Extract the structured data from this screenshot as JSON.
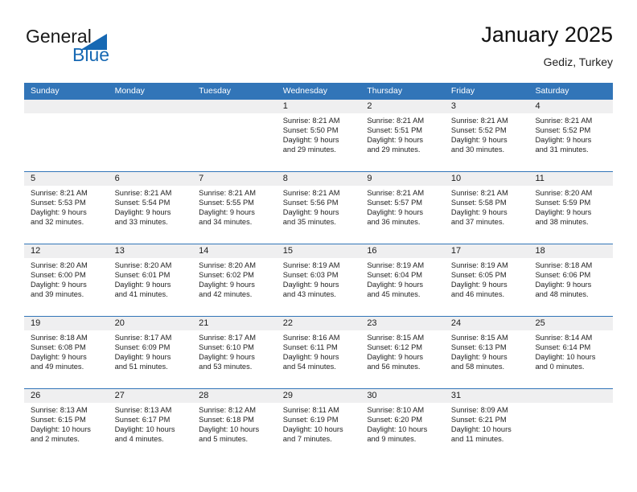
{
  "brand": {
    "name_part1": "General",
    "name_part2": "Blue",
    "logo_icon": "triangle-flag-icon",
    "color_blue": "#1668b3"
  },
  "header": {
    "title": "January 2025",
    "subtitle": "Gediz, Turkey"
  },
  "theme": {
    "header_blue": "#3275b8",
    "day_band_gray": "#efeff0",
    "text_dark": "#222222"
  },
  "weekday_headers": [
    "Sunday",
    "Monday",
    "Tuesday",
    "Wednesday",
    "Thursday",
    "Friday",
    "Saturday"
  ],
  "labels": {
    "sunrise_prefix": "Sunrise:",
    "sunset_prefix": "Sunset:",
    "daylight_prefix": "Daylight:"
  },
  "weeks": [
    {
      "days": [
        {
          "number": "",
          "line1": "",
          "line2": "",
          "line3": "",
          "line4": "",
          "empty": true
        },
        {
          "number": "",
          "line1": "",
          "line2": "",
          "line3": "",
          "line4": "",
          "empty": true
        },
        {
          "number": "",
          "line1": "",
          "line2": "",
          "line3": "",
          "line4": "",
          "empty": true
        },
        {
          "number": "1",
          "line1": "Sunrise: 8:21 AM",
          "line2": "Sunset: 5:50 PM",
          "line3": "Daylight: 9 hours",
          "line4": "and 29 minutes.",
          "empty": false
        },
        {
          "number": "2",
          "line1": "Sunrise: 8:21 AM",
          "line2": "Sunset: 5:51 PM",
          "line3": "Daylight: 9 hours",
          "line4": "and 29 minutes.",
          "empty": false
        },
        {
          "number": "3",
          "line1": "Sunrise: 8:21 AM",
          "line2": "Sunset: 5:52 PM",
          "line3": "Daylight: 9 hours",
          "line4": "and 30 minutes.",
          "empty": false
        },
        {
          "number": "4",
          "line1": "Sunrise: 8:21 AM",
          "line2": "Sunset: 5:52 PM",
          "line3": "Daylight: 9 hours",
          "line4": "and 31 minutes.",
          "empty": false
        }
      ]
    },
    {
      "days": [
        {
          "number": "5",
          "line1": "Sunrise: 8:21 AM",
          "line2": "Sunset: 5:53 PM",
          "line3": "Daylight: 9 hours",
          "line4": "and 32 minutes.",
          "empty": false
        },
        {
          "number": "6",
          "line1": "Sunrise: 8:21 AM",
          "line2": "Sunset: 5:54 PM",
          "line3": "Daylight: 9 hours",
          "line4": "and 33 minutes.",
          "empty": false
        },
        {
          "number": "7",
          "line1": "Sunrise: 8:21 AM",
          "line2": "Sunset: 5:55 PM",
          "line3": "Daylight: 9 hours",
          "line4": "and 34 minutes.",
          "empty": false
        },
        {
          "number": "8",
          "line1": "Sunrise: 8:21 AM",
          "line2": "Sunset: 5:56 PM",
          "line3": "Daylight: 9 hours",
          "line4": "and 35 minutes.",
          "empty": false
        },
        {
          "number": "9",
          "line1": "Sunrise: 8:21 AM",
          "line2": "Sunset: 5:57 PM",
          "line3": "Daylight: 9 hours",
          "line4": "and 36 minutes.",
          "empty": false
        },
        {
          "number": "10",
          "line1": "Sunrise: 8:21 AM",
          "line2": "Sunset: 5:58 PM",
          "line3": "Daylight: 9 hours",
          "line4": "and 37 minutes.",
          "empty": false
        },
        {
          "number": "11",
          "line1": "Sunrise: 8:20 AM",
          "line2": "Sunset: 5:59 PM",
          "line3": "Daylight: 9 hours",
          "line4": "and 38 minutes.",
          "empty": false
        }
      ]
    },
    {
      "days": [
        {
          "number": "12",
          "line1": "Sunrise: 8:20 AM",
          "line2": "Sunset: 6:00 PM",
          "line3": "Daylight: 9 hours",
          "line4": "and 39 minutes.",
          "empty": false
        },
        {
          "number": "13",
          "line1": "Sunrise: 8:20 AM",
          "line2": "Sunset: 6:01 PM",
          "line3": "Daylight: 9 hours",
          "line4": "and 41 minutes.",
          "empty": false
        },
        {
          "number": "14",
          "line1": "Sunrise: 8:20 AM",
          "line2": "Sunset: 6:02 PM",
          "line3": "Daylight: 9 hours",
          "line4": "and 42 minutes.",
          "empty": false
        },
        {
          "number": "15",
          "line1": "Sunrise: 8:19 AM",
          "line2": "Sunset: 6:03 PM",
          "line3": "Daylight: 9 hours",
          "line4": "and 43 minutes.",
          "empty": false
        },
        {
          "number": "16",
          "line1": "Sunrise: 8:19 AM",
          "line2": "Sunset: 6:04 PM",
          "line3": "Daylight: 9 hours",
          "line4": "and 45 minutes.",
          "empty": false
        },
        {
          "number": "17",
          "line1": "Sunrise: 8:19 AM",
          "line2": "Sunset: 6:05 PM",
          "line3": "Daylight: 9 hours",
          "line4": "and 46 minutes.",
          "empty": false
        },
        {
          "number": "18",
          "line1": "Sunrise: 8:18 AM",
          "line2": "Sunset: 6:06 PM",
          "line3": "Daylight: 9 hours",
          "line4": "and 48 minutes.",
          "empty": false
        }
      ]
    },
    {
      "days": [
        {
          "number": "19",
          "line1": "Sunrise: 8:18 AM",
          "line2": "Sunset: 6:08 PM",
          "line3": "Daylight: 9 hours",
          "line4": "and 49 minutes.",
          "empty": false
        },
        {
          "number": "20",
          "line1": "Sunrise: 8:17 AM",
          "line2": "Sunset: 6:09 PM",
          "line3": "Daylight: 9 hours",
          "line4": "and 51 minutes.",
          "empty": false
        },
        {
          "number": "21",
          "line1": "Sunrise: 8:17 AM",
          "line2": "Sunset: 6:10 PM",
          "line3": "Daylight: 9 hours",
          "line4": "and 53 minutes.",
          "empty": false
        },
        {
          "number": "22",
          "line1": "Sunrise: 8:16 AM",
          "line2": "Sunset: 6:11 PM",
          "line3": "Daylight: 9 hours",
          "line4": "and 54 minutes.",
          "empty": false
        },
        {
          "number": "23",
          "line1": "Sunrise: 8:15 AM",
          "line2": "Sunset: 6:12 PM",
          "line3": "Daylight: 9 hours",
          "line4": "and 56 minutes.",
          "empty": false
        },
        {
          "number": "24",
          "line1": "Sunrise: 8:15 AM",
          "line2": "Sunset: 6:13 PM",
          "line3": "Daylight: 9 hours",
          "line4": "and 58 minutes.",
          "empty": false
        },
        {
          "number": "25",
          "line1": "Sunrise: 8:14 AM",
          "line2": "Sunset: 6:14 PM",
          "line3": "Daylight: 10 hours",
          "line4": "and 0 minutes.",
          "empty": false
        }
      ]
    },
    {
      "days": [
        {
          "number": "26",
          "line1": "Sunrise: 8:13 AM",
          "line2": "Sunset: 6:15 PM",
          "line3": "Daylight: 10 hours",
          "line4": "and 2 minutes.",
          "empty": false
        },
        {
          "number": "27",
          "line1": "Sunrise: 8:13 AM",
          "line2": "Sunset: 6:17 PM",
          "line3": "Daylight: 10 hours",
          "line4": "and 4 minutes.",
          "empty": false
        },
        {
          "number": "28",
          "line1": "Sunrise: 8:12 AM",
          "line2": "Sunset: 6:18 PM",
          "line3": "Daylight: 10 hours",
          "line4": "and 5 minutes.",
          "empty": false
        },
        {
          "number": "29",
          "line1": "Sunrise: 8:11 AM",
          "line2": "Sunset: 6:19 PM",
          "line3": "Daylight: 10 hours",
          "line4": "and 7 minutes.",
          "empty": false
        },
        {
          "number": "30",
          "line1": "Sunrise: 8:10 AM",
          "line2": "Sunset: 6:20 PM",
          "line3": "Daylight: 10 hours",
          "line4": "and 9 minutes.",
          "empty": false
        },
        {
          "number": "31",
          "line1": "Sunrise: 8:09 AM",
          "line2": "Sunset: 6:21 PM",
          "line3": "Daylight: 10 hours",
          "line4": "and 11 minutes.",
          "empty": false
        },
        {
          "number": "",
          "line1": "",
          "line2": "",
          "line3": "",
          "line4": "",
          "empty": true
        }
      ]
    }
  ]
}
